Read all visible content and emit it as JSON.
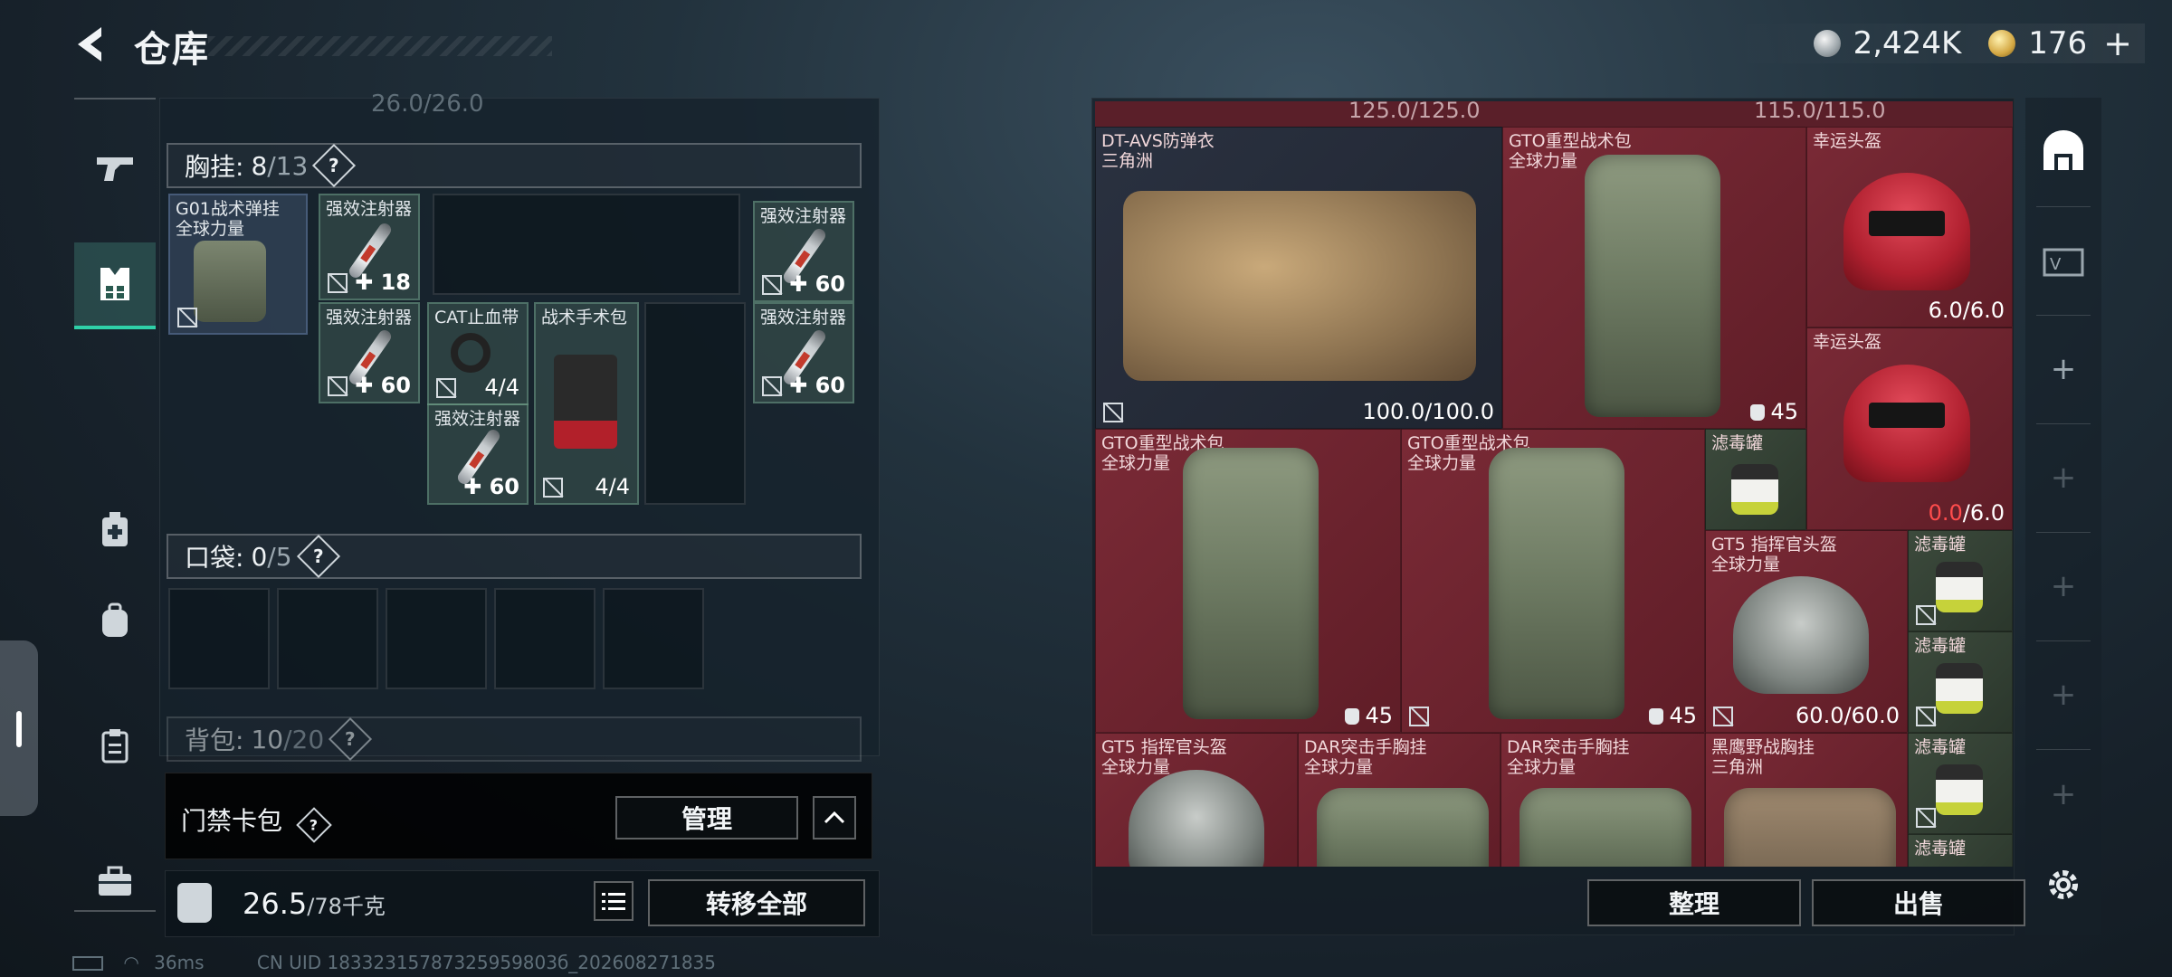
{
  "header": {
    "title": "仓库",
    "currency_silver": "2,424K",
    "currency_gold": "176",
    "add_label": "+"
  },
  "left_panel": {
    "faded_top_value": "26.0/26.0",
    "chest_rig": {
      "label": "胸挂:",
      "count": "8",
      "max": "/13",
      "help": "?"
    },
    "rig_item": {
      "name": "G01战术弹挂",
      "sub": "全球力量"
    },
    "rig_slots": [
      {
        "name": "强效注射器",
        "qty": "18"
      },
      {
        "name": "强效注射器",
        "qty": "60"
      },
      {
        "name": "CAT止血带",
        "qty": "4/4"
      },
      {
        "name": "强效注射器",
        "qty": "60"
      },
      {
        "name": "战术手术包",
        "qty": "4/4"
      },
      {
        "name": "强效注射器",
        "qty": "60"
      },
      {
        "name": "强效注射器",
        "qty": "60"
      }
    ],
    "pocket": {
      "label": "口袋:",
      "count": "0",
      "max": "/5",
      "help": "?"
    },
    "backpack": {
      "label": "背包:",
      "count": "10",
      "max": "/20",
      "help": "?"
    }
  },
  "card_bar": {
    "label": "门禁卡包",
    "help": "?",
    "manage_label": "管理"
  },
  "weight": {
    "current": "26.5",
    "max": "/78千克"
  },
  "transfer_all_label": "转移全部",
  "status": {
    "ping": "36ms",
    "uid": "CN UID 18332315787325959803б_202608271835"
  },
  "stash": {
    "top_values": [
      "125.0/125.0",
      "115.0/115.0"
    ],
    "items": [
      {
        "name": "DT-AVS防弹衣",
        "sub": "三角洲",
        "value": "100.0/100.0"
      },
      {
        "name": "GTO重型战术包",
        "sub": "全球力量",
        "value": "45"
      },
      {
        "name": "幸运头盔",
        "sub": "",
        "value": "6.0/6.0"
      },
      {
        "name": "幸运头盔",
        "sub": "",
        "value_red": "0.0",
        "value_rest": "/6.0"
      },
      {
        "name": "GTO重型战术包",
        "sub": "全球力量",
        "value": "45"
      },
      {
        "name": "GTO重型战术包",
        "sub": "全球力量",
        "value": "45"
      },
      {
        "name": "滤毒罐",
        "sub": "",
        "value": ""
      },
      {
        "name": "GT5 指挥官头盔",
        "sub": "全球力量",
        "value": "60.0/60.0"
      },
      {
        "name": "滤毒罐",
        "sub": "",
        "value": ""
      },
      {
        "name": "滤毒罐",
        "sub": "",
        "value": ""
      },
      {
        "name": "GT5 指挥官头盔",
        "sub": "全球力量",
        "value": ""
      },
      {
        "name": "DAR突击手胸挂",
        "sub": "全球力量",
        "value": ""
      },
      {
        "name": "DAR突击手胸挂",
        "sub": "全球力量",
        "value": ""
      },
      {
        "name": "黑鹰野战胸挂",
        "sub": "三角洲",
        "value": ""
      },
      {
        "name": "滤毒罐",
        "sub": "",
        "value": ""
      },
      {
        "name": "滤毒罐",
        "sub": "",
        "value": ""
      }
    ],
    "sort_label": "整理",
    "sell_label": "出售"
  },
  "right_nav": {
    "add_items": [
      "+",
      "+",
      "+",
      "+",
      "+"
    ]
  }
}
